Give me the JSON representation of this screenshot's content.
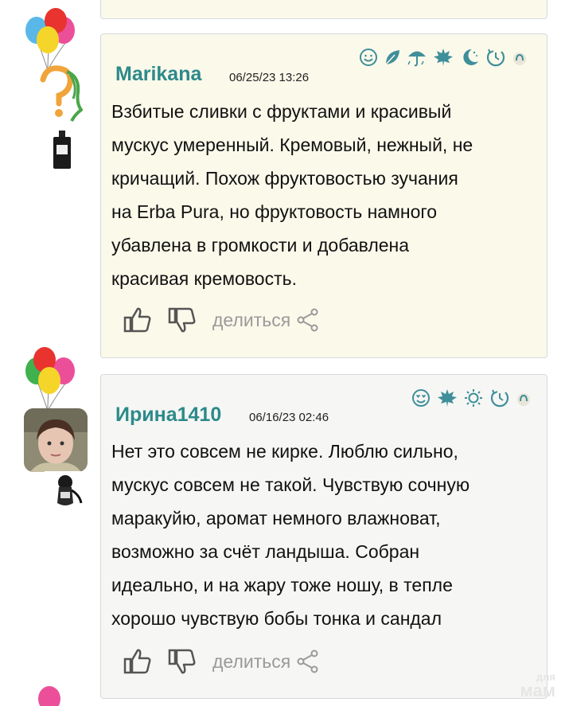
{
  "colors": {
    "username": "#2c8a8a",
    "icon_teal": "#3f8f9a",
    "card_cream": "#fbf9ea",
    "card_grey": "#f6f6f4",
    "action_grey": "#9a9a9a"
  },
  "comments": [
    {
      "username": "Marikana",
      "date": "06/25/23 13:26",
      "text_lines": [
        "Взбитые сливки с фруктами и красивый",
        "мускус умеренный. Кремовый, нежный, не",
        "кричащий. Похож фруктовостью зучания",
        "на Erba Pura, но фруктовость намного",
        "убавлена в громкости и добавлена",
        "красивая кремовость."
      ],
      "season_icons": [
        "smile-icon",
        "leaf-icon",
        "umbrella-icon",
        "maple-leaf-icon",
        "moon-icon",
        "clock-icon",
        "night-icon"
      ],
      "share_label": "делиться"
    },
    {
      "username": "Ирина1410",
      "date": "06/16/23 02:46",
      "text_lines": [
        "Нет это совсем не кирке. Люблю сильно,",
        "мускус совсем не такой. Чувствую сочную",
        "маракуйю, аромат немного влажноват,",
        "возможно за счёт ландыша. Собран",
        "идеально, и на жару тоже ношу, в тепле",
        "хорошо чувствую бобы тонка и сандал"
      ],
      "season_icons": [
        "heart-eyes-icon",
        "maple-leaf-icon",
        "sun-icon",
        "clock-icon",
        "night-icon"
      ],
      "share_label": "делиться"
    }
  ],
  "watermark": {
    "line1": "для",
    "line2": "мам"
  }
}
